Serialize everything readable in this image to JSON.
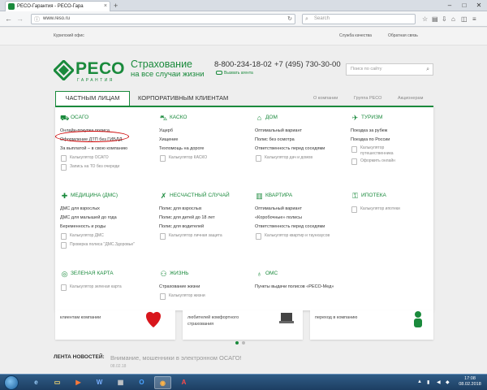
{
  "browser": {
    "tab_title": "РЕСО-Гарантия - РЕСО-Гара",
    "tab_close": "×",
    "new_tab": "+",
    "url": "www.reso.ru",
    "search_placeholder": "Search",
    "win_min": "–",
    "win_max": "□",
    "win_close": "✕",
    "back": "←",
    "forward": "→",
    "reload": "↻"
  },
  "site": {
    "top_office": "Курилский офис",
    "top_quality": "Служба качества",
    "top_feedback": "Обратная связь",
    "logo_name": "РЕСО",
    "logo_sub": "ГАРАНТИЯ",
    "slogan_line1": "Страхование",
    "slogan_line2": "на все случаи жизни",
    "phone1": "8-800-234-18-02",
    "phone2": "+7 (495) 730-30-00",
    "call_agent": "Вызвать агента",
    "search_placeholder": "Поиск по сайту",
    "tab_private": "ЧАСТНЫМ ЛИЦАМ",
    "tab_corporate": "КОРПОРАТИВНЫМ КЛИЕНТАМ",
    "link_about": "О компании",
    "link_group": "Группа РЕСО",
    "link_shareholders": "Акционерам"
  },
  "menu": {
    "osago": {
      "title": "ОСАГО",
      "links": [
        "Онлайн-покупка полиса",
        "Оформление ДТП без ГИБДД",
        "За выплатой – в свою компанию"
      ],
      "calc": "Калькулятор ОСАГО",
      "extra": "Запись на ТО без очереди"
    },
    "kasko": {
      "title": "КАСКО",
      "links": [
        "Ущерб",
        "Хищение",
        "Техпомощь на дороге"
      ],
      "calc": "Калькулятор КАСКО"
    },
    "dom": {
      "title": "ДОМ",
      "links": [
        "Оптимальный вариант",
        "Полис без осмотра",
        "Ответственность перед соседями"
      ],
      "calc": "Калькулятор дач и домов"
    },
    "turizm": {
      "title": "ТУРИЗМ",
      "links": [
        "Поездка за рубеж",
        "Поездка по России"
      ],
      "calc_line1": "Калькулятор",
      "calc_line2": "путешественника",
      "extra": "Оформить онлайн"
    },
    "dms": {
      "title": "МЕДИЦИНА (ДМС)",
      "links": [
        "ДМС для взрослых",
        "ДМС для малышей до года",
        "Беременность и роды"
      ],
      "calc": "Калькулятор ДМС",
      "extra": "Проверка полиса \"ДМС.Здоровье\""
    },
    "ns": {
      "title": "НЕСЧАСТНЫЙ СЛУЧАЙ",
      "links": [
        "Полис для взрослых",
        "Полис для детей до 18 лет",
        "Полис для водителей"
      ],
      "calc": "Калькулятор личная защита"
    },
    "kvartira": {
      "title": "КВАРТИРА",
      "links": [
        "Оптимальный вариант",
        "«Коробочные» полисы",
        "Ответственность перед соседями"
      ],
      "calc": "Калькулятор квартир и таунхаусов"
    },
    "ipoteka": {
      "title": "ИПОТЕКА",
      "calc": "Калькулятор ипотеки"
    },
    "zk": {
      "title": "ЗЕЛЕНАЯ КАРТА",
      "calc": "Калькулятор зеленая карта"
    },
    "zhizn": {
      "title": "ЖИЗНЬ",
      "links": [
        "Страхование жизни"
      ],
      "calc": "Калькулятор жизни"
    },
    "oms": {
      "title": "ОМС",
      "links": [
        "Пункты выдачи полисов «РЕСО-Мед»"
      ]
    }
  },
  "cards": {
    "card1": "клиентам компании",
    "card2_line1": "любителей комфортного",
    "card2_line2": "страхования",
    "card3": "переход в компанию"
  },
  "news": {
    "label": "ЛЕНТА НОВОСТЕЙ:",
    "text": "Внимание, мошенники в электронном ОСАГО!",
    "date": "08.02.18"
  },
  "taskbar": {
    "time": "17:08",
    "date": "08.02.2018"
  },
  "colors": {
    "brand_green": "#1a8a3c",
    "highlight_red": "#cc0000"
  }
}
